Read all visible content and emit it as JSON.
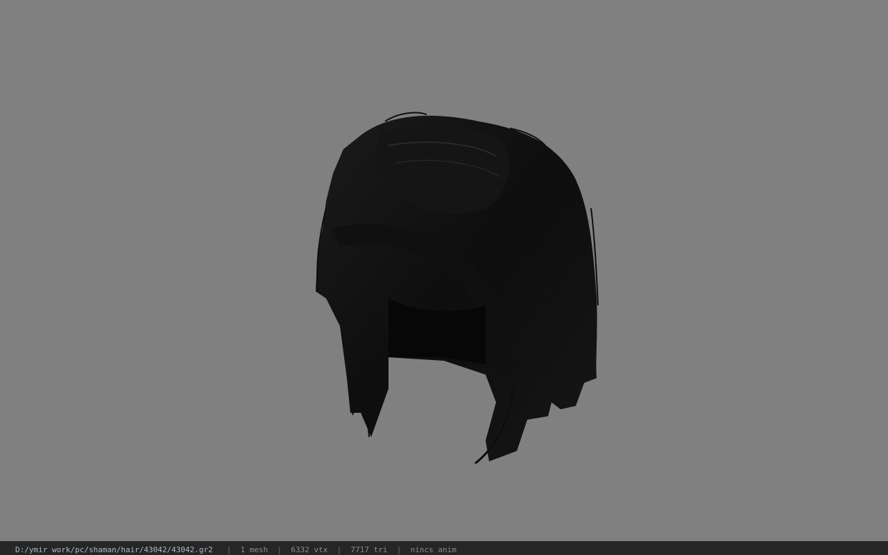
{
  "viewport": {
    "background": "#808080",
    "model_color": "#0c0c0c"
  },
  "statusbar": {
    "file_path": "D:/ymir work/pc/shaman/hair/43042/43042.gr2",
    "separator": "|",
    "mesh_count": "1 mesh",
    "vertex_count": "6332 vtx",
    "triangle_count": "7717 tri",
    "anim_status": "nincs anim"
  }
}
